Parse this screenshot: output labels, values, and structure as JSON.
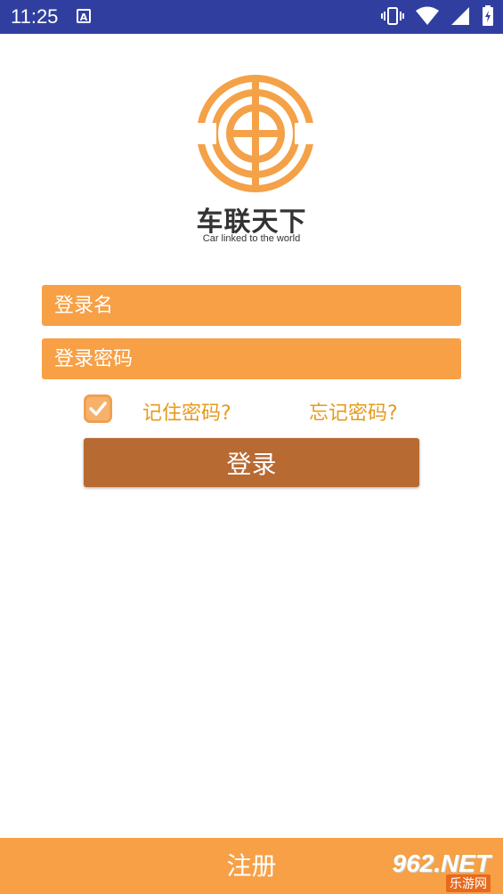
{
  "status_bar": {
    "time": "11:25",
    "notification_icon": "A"
  },
  "brand": {
    "name_cn": "车联天下",
    "tagline_en": "Car linked to the world",
    "logo_icon": "steering-wheel-logo",
    "color": "#f4a148"
  },
  "form": {
    "username_placeholder": "登录名",
    "password_placeholder": "登录密码",
    "remember_label": "记住密码?",
    "remember_checked": true,
    "forgot_label": "忘记密码?",
    "login_label": "登录"
  },
  "footer": {
    "register_label": "注册"
  },
  "watermark": {
    "number": "962.NET",
    "subtitle": "乐游网"
  },
  "colors": {
    "status_bar": "#303f9f",
    "field": "#f7a046",
    "link": "#e69a1c",
    "button": "#b86a33"
  }
}
